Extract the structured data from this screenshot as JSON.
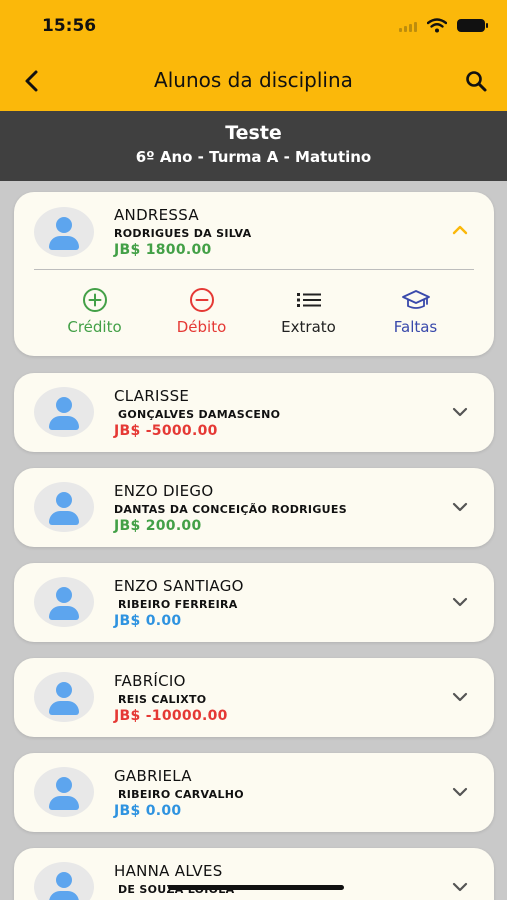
{
  "status_bar": {
    "time": "15:56"
  },
  "header": {
    "title": "Alunos da disciplina"
  },
  "class_info": {
    "name": "Teste",
    "subtitle": "6º Ano - Turma A - Matutino"
  },
  "colors": {
    "accent": "#fbb80a",
    "positive": "#43a047",
    "negative": "#e53935",
    "zero": "#2f93e0",
    "faltas": "#3949ab"
  },
  "expanded_actions": [
    {
      "label": "Crédito",
      "icon": "plus-circle-icon",
      "color": "#43a047"
    },
    {
      "label": "Débito",
      "icon": "minus-circle-icon",
      "color": "#e53935"
    },
    {
      "label": "Extrato",
      "icon": "list-icon",
      "color": "#222222"
    },
    {
      "label": "Faltas",
      "icon": "graduation-cap-icon",
      "color": "#3949ab"
    }
  ],
  "students": [
    {
      "first_name": "ANDRESSA",
      "last_name": "RODRIGUES DA SILVA",
      "balance": "JB$ 1800.00",
      "balance_status": "positive",
      "expanded": true
    },
    {
      "first_name": "CLARISSE",
      "last_name": "GONÇALVES DAMASCENO",
      "balance": "JB$ -5000.00",
      "balance_status": "negative",
      "expanded": false
    },
    {
      "first_name": "ENZO DIEGO",
      "last_name": "DANTAS DA CONCEIÇÃO RODRIGUES",
      "balance": "JB$ 200.00",
      "balance_status": "positive",
      "expanded": false
    },
    {
      "first_name": "ENZO SANTIAGO",
      "last_name": "RIBEIRO FERREIRA",
      "balance": "JB$ 0.00",
      "balance_status": "zero",
      "expanded": false
    },
    {
      "first_name": "FABRÍCIO",
      "last_name": "REIS CALIXTO",
      "balance": "JB$ -10000.00",
      "balance_status": "negative",
      "expanded": false
    },
    {
      "first_name": "GABRIELA",
      "last_name": "RIBEIRO CARVALHO",
      "balance": "JB$ 0.00",
      "balance_status": "zero",
      "expanded": false
    },
    {
      "first_name": "HANNA ALVES",
      "last_name": "DE SOUZA LOIOLA",
      "balance": "",
      "balance_status": "",
      "expanded": false
    }
  ]
}
